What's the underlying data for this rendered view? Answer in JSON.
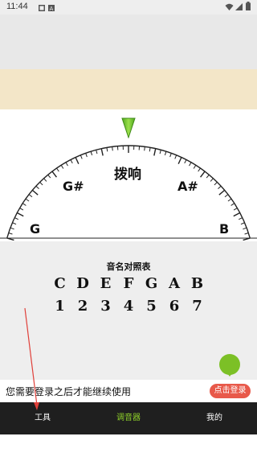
{
  "status_bar": {
    "time": "11:44",
    "icons": [
      "gallery-icon",
      "sim-icon",
      "wifi-icon",
      "signal-icon",
      "battery-icon"
    ]
  },
  "tuner": {
    "center_label": "拨响",
    "notes": [
      "G",
      "G#",
      "A#",
      "B"
    ],
    "pointer_color": "#6cc62a"
  },
  "note_table": {
    "title": "音名对照表",
    "letters": [
      "C",
      "D",
      "E",
      "F",
      "G",
      "A",
      "B"
    ],
    "digits": [
      "1",
      "2",
      "3",
      "4",
      "5",
      "6",
      "7"
    ]
  },
  "login_bar": {
    "message": "您需要登录之后才能继续使用",
    "button_label": "点击登录"
  },
  "tabs": [
    {
      "label": "工具",
      "active": false
    },
    {
      "label": "调音器",
      "active": true
    },
    {
      "label": "我的",
      "active": false
    }
  ],
  "colors": {
    "accent_green": "#8fd12a",
    "login_button": "#e8594a",
    "banner": "#f3e6c8",
    "annotation_arrow": "#e0403a"
  }
}
